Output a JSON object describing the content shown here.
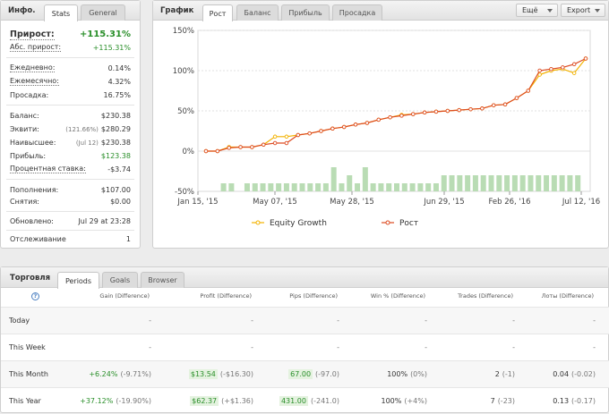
{
  "info": {
    "title": "Инфо.",
    "tabs": [
      {
        "label": "Stats"
      },
      {
        "label": "General"
      }
    ],
    "rows": {
      "gain": {
        "label": "Прирост:",
        "value": "+115.31%"
      },
      "abs_gain": {
        "label": "Абс. прирост:",
        "value": "+115.31%"
      },
      "daily": {
        "label": "Ежедневно:",
        "value": "0.14%"
      },
      "monthly": {
        "label": "Ежемесячно:",
        "value": "4.32%"
      },
      "drawdown": {
        "label": "Просадка:",
        "value": "16.75%"
      },
      "balance": {
        "label": "Баланс:",
        "value": "$230.38"
      },
      "equity": {
        "label": "Эквити:",
        "sub": "(121.66%)",
        "value": "$280.29"
      },
      "highest": {
        "label": "Наивысшее:",
        "sub": "(Jul 12)",
        "value": "$230.38"
      },
      "profit": {
        "label": "Прибыль:",
        "value": "$123.38"
      },
      "interest": {
        "label": "Процентная ставка:",
        "value": "-$3.74"
      },
      "deposits": {
        "label": "Пополнения:",
        "value": "$107.00"
      },
      "withdrawals": {
        "label": "Снятия:",
        "value": "$0.00"
      },
      "updated": {
        "label": "Обновлено:",
        "value": "Jul 29 at 23:28"
      },
      "tracking": {
        "label": "Отслеживание",
        "value": "1"
      }
    }
  },
  "graph": {
    "title": "График",
    "tabs": [
      {
        "label": "Рост"
      },
      {
        "label": "Баланс"
      },
      {
        "label": "Прибыль"
      },
      {
        "label": "Просадка"
      }
    ],
    "more_label": "Ещё",
    "export_label": "Export"
  },
  "chart_data": {
    "type": "line",
    "y_ticks": [
      "150%",
      "100%",
      "50%",
      "0%",
      "-50%"
    ],
    "ylim": [
      -50,
      150
    ],
    "x_ticks": [
      "Jan 15, '15",
      "May 07, '15",
      "May 28, '15",
      "Jun 29, '15",
      "Feb 26, '16",
      "Jul 12, '16"
    ],
    "legend": [
      {
        "name": "Equity Growth",
        "color": "#f2b200"
      },
      {
        "name": "Рост",
        "color": "#dd4b21"
      }
    ],
    "series": [
      {
        "name": "Equity Growth",
        "values": [
          0,
          0,
          5,
          5,
          5,
          8,
          18,
          18,
          20,
          22,
          25,
          28,
          30,
          33,
          35,
          39,
          42,
          45,
          46,
          48,
          49,
          50,
          51,
          52,
          53,
          57,
          58,
          66,
          75,
          95,
          100,
          102,
          97,
          115
        ]
      },
      {
        "name": "Рост",
        "values": [
          0,
          0,
          4,
          5,
          5,
          8,
          10,
          10,
          20,
          22,
          25,
          28,
          30,
          33,
          35,
          39,
          42,
          44,
          46,
          48,
          49,
          50,
          51,
          52,
          53,
          57,
          58,
          66,
          75,
          100,
          102,
          104,
          108,
          115
        ]
      }
    ],
    "bars": [
      0,
      0,
      1,
      1,
      0,
      1,
      1,
      1,
      1,
      1,
      1,
      1,
      1,
      1,
      1,
      1,
      3,
      1,
      2,
      1,
      3,
      1,
      1,
      1,
      1,
      1,
      1,
      1,
      1,
      1,
      2,
      2,
      2,
      2,
      2,
      2,
      2,
      2,
      2,
      2,
      2,
      2,
      2,
      2,
      2,
      2,
      2,
      2
    ]
  },
  "trading": {
    "title": "Торговля",
    "tabs": [
      {
        "label": "Periods"
      },
      {
        "label": "Goals"
      },
      {
        "label": "Browser"
      }
    ],
    "columns": [
      "Gain (Difference)",
      "Profit (Difference)",
      "Pips (Difference)",
      "Win % (Difference)",
      "Trades (Difference)",
      "Лоты (Difference)"
    ],
    "rows": [
      {
        "period": "Today",
        "gain": "-",
        "gain_diff": "",
        "profit": "-",
        "profit_diff": "",
        "pips": "-",
        "pips_diff": "",
        "win": "-",
        "win_diff": "",
        "trades": "-",
        "trades_diff": "",
        "lots": "-",
        "lots_diff": ""
      },
      {
        "period": "This Week",
        "gain": "-",
        "gain_diff": "",
        "profit": "-",
        "profit_diff": "",
        "pips": "-",
        "pips_diff": "",
        "win": "-",
        "win_diff": "",
        "trades": "-",
        "trades_diff": "",
        "lots": "-",
        "lots_diff": ""
      },
      {
        "period": "This Month",
        "gain": "+6.24%",
        "gain_diff": "(-9.71%)",
        "profit": "$13.54",
        "profit_diff": "(-$16.30)",
        "pips": "67.00",
        "pips_diff": "(-97.0)",
        "win": "100%",
        "win_diff": "(0%)",
        "trades": "2",
        "trades_diff": "(-1)",
        "lots": "0.04",
        "lots_diff": "(-0.02)"
      },
      {
        "period": "This Year",
        "gain": "+37.12%",
        "gain_diff": "(-19.90%)",
        "profit": "$62.37",
        "profit_diff": "(+$1.36)",
        "pips": "431.00",
        "pips_diff": "(-241.0)",
        "win": "100%",
        "win_diff": "(+4%)",
        "trades": "7",
        "trades_diff": "(-23)",
        "lots": "0.13",
        "lots_diff": "(-0.17)"
      }
    ]
  }
}
